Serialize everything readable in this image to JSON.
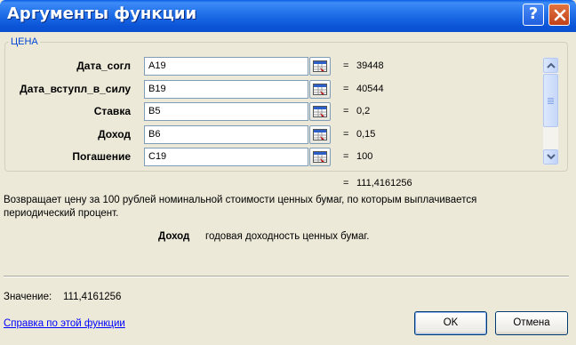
{
  "window": {
    "title": "Аргументы функции",
    "help_symbol": "?"
  },
  "function": {
    "name": "ЦЕНА",
    "args": [
      {
        "label": "Дата_согл",
        "input": "A19",
        "value": "39448"
      },
      {
        "label": "Дата_вступл_в_силу",
        "input": "B19",
        "value": "40544"
      },
      {
        "label": "Ставка",
        "input": "B5",
        "value": "0,2"
      },
      {
        "label": "Доход",
        "input": "B6",
        "value": "0,15"
      },
      {
        "label": "Погашение",
        "input": "C19",
        "value": "100"
      }
    ],
    "equals": "=",
    "result": "111,4161256",
    "description": "Возвращает цену за 100 рублей номинальной стоимости ценных бумаг, по которым выплачивается периодический процент.",
    "arg_desc_name": "Доход",
    "arg_desc_text": "годовая доходность ценных бумаг."
  },
  "footer": {
    "value_label": "Значение:",
    "value": "111,4161256",
    "help_link": "Справка по этой функции",
    "ok_label": "OK",
    "cancel_label": "Отмена"
  }
}
